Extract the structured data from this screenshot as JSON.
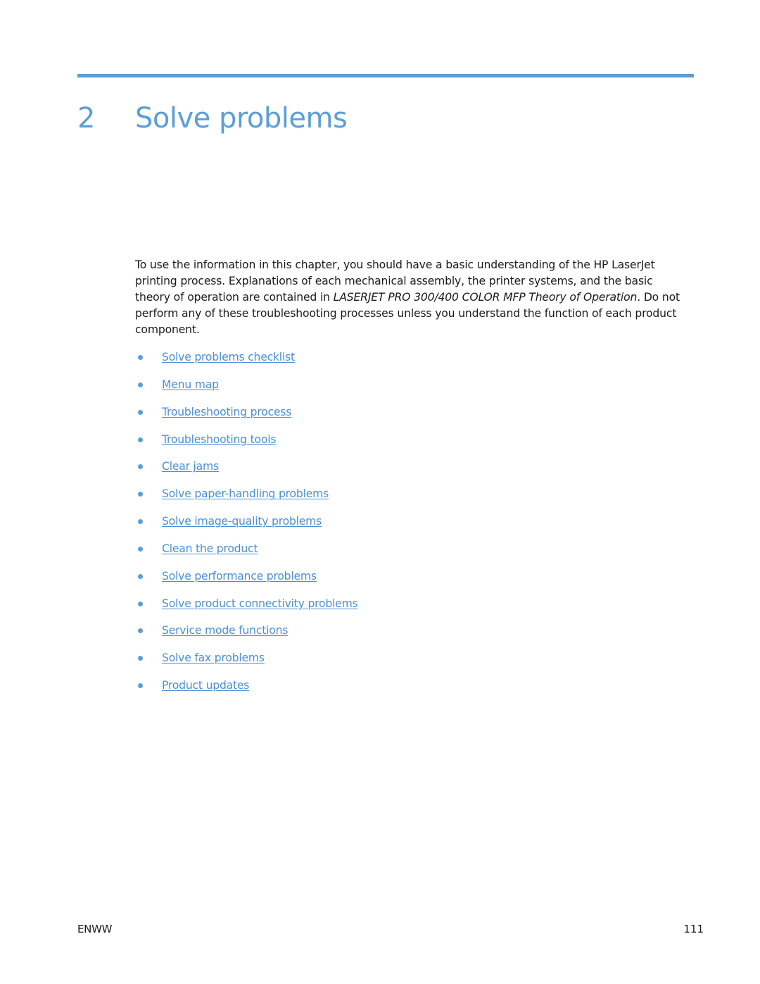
{
  "colors": {
    "accent": "#5b9fd6",
    "link": "#4a8fd4",
    "text": "#1a1a1a"
  },
  "chapter": {
    "number": "2",
    "title": "Solve problems"
  },
  "intro": {
    "text_before": "To use the information in this chapter, you should have a basic understanding of the HP LaserJet printing process. Explanations of each mechanical assembly, the printer systems, and the basic theory of operation are contained in ",
    "italic": "LASERJET PRO 300/400 COLOR MFP Theory of Operation",
    "text_after": ". Do not perform any of these troubleshooting processes unless you understand the function of each product component."
  },
  "links": [
    {
      "label": "Solve problems checklist"
    },
    {
      "label": "Menu map"
    },
    {
      "label": "Troubleshooting process"
    },
    {
      "label": "Troubleshooting tools"
    },
    {
      "label": "Clear jams"
    },
    {
      "label": "Solve paper-handling problems"
    },
    {
      "label": "Solve image-quality problems"
    },
    {
      "label": "Clean the product"
    },
    {
      "label": "Solve performance problems"
    },
    {
      "label": "Solve product connectivity problems"
    },
    {
      "label": "Service mode functions"
    },
    {
      "label": "Solve fax problems"
    },
    {
      "label": "Product updates"
    }
  ],
  "footer": {
    "left": "ENWW",
    "page_number": "111"
  }
}
